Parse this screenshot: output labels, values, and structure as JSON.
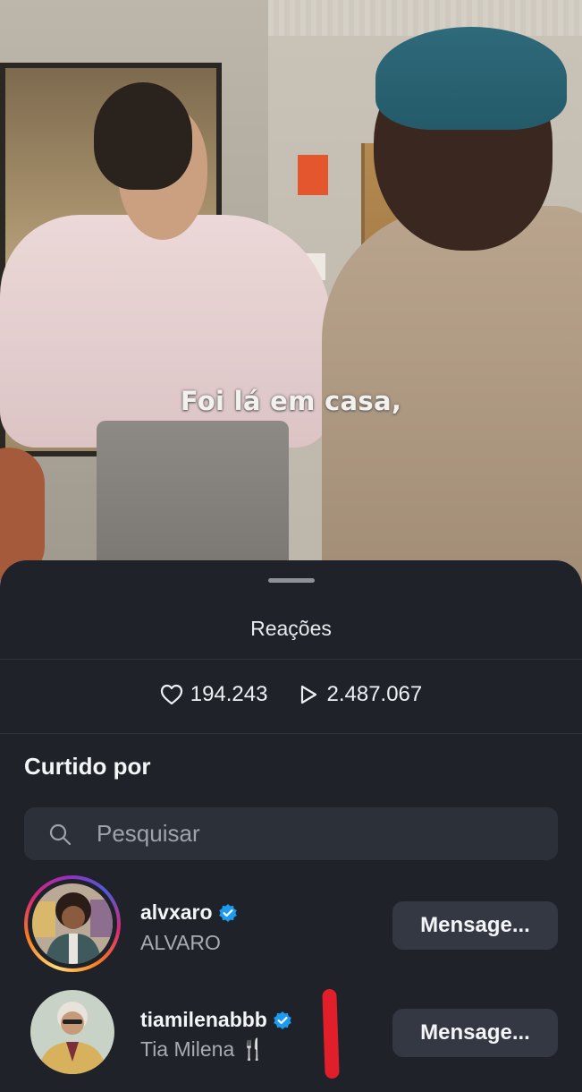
{
  "video": {
    "subtitle": "Foi lá em casa,"
  },
  "sheet": {
    "title": "Reações",
    "stats": {
      "likes": "194.243",
      "plays": "2.487.067",
      "like_icon": "heart-icon",
      "play_icon": "play-icon"
    },
    "liked_by_title": "Curtido por",
    "search": {
      "placeholder": "Pesquisar",
      "icon": "search-icon"
    },
    "users": [
      {
        "username": "alvxaro",
        "full_name": "ALVARO",
        "verified": true,
        "has_story": true,
        "button_label": "Mensage..."
      },
      {
        "username": "tiamilenabbb",
        "full_name": "Tia Milena 🍴",
        "verified": true,
        "has_story": false,
        "button_label": "Mensage..."
      }
    ]
  },
  "colors": {
    "background": "#1f2229",
    "button": "#343843",
    "verified": "#1d9bf0",
    "annotation_mark": "#e11f2a"
  }
}
